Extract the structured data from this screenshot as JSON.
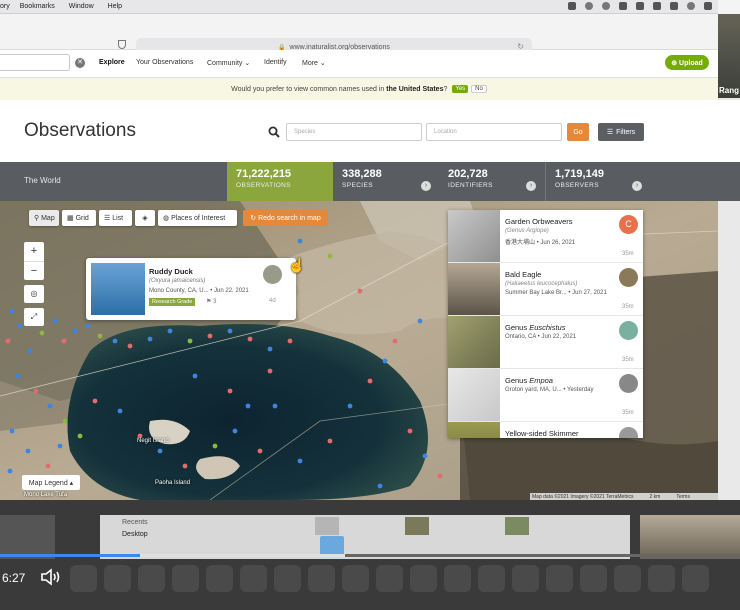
{
  "menubar": {
    "items": [
      "ory",
      "Bookmarks",
      "Window",
      "Help"
    ]
  },
  "sidecam": {
    "label": "Rang"
  },
  "browser": {
    "url": "www.inaturalist.org/observations"
  },
  "nav": {
    "items": [
      "Explore",
      "Your Observations",
      "Community ⌄",
      "Identify",
      "More ⌄"
    ],
    "upload": "⊕ Upload"
  },
  "banner": {
    "text_pre": "Would you prefer to view common names used in",
    "country": "the United States",
    "text_post": "?",
    "yes": "Yes",
    "no": "No"
  },
  "page": {
    "title": "Observations",
    "species_placeholder": "Species",
    "location_placeholder": "Location",
    "go": "Go",
    "filters": "Filters"
  },
  "stats": {
    "place": "The World",
    "observations": {
      "num": "71,222,215",
      "label": "OBSERVATIONS"
    },
    "species": {
      "num": "338,288",
      "label": "SPECIES"
    },
    "identifiers": {
      "num": "202,728",
      "label": "IDENTIFIERS"
    },
    "observers": {
      "num": "1,719,149",
      "label": "OBSERVERS"
    }
  },
  "map": {
    "controls": [
      "Map",
      "Grid",
      "List",
      "",
      "Places of Interest"
    ],
    "redo": "Redo search in map",
    "legend": "Map Legend ▴",
    "attribution": "Map data ©2021 Imagery ©2021 TerraMetrics",
    "scale": "2 km",
    "terms": "Terms",
    "place_labels": [
      "Negit Island",
      "Paoha Island",
      "Mono Lake Tufa"
    ]
  },
  "popup": {
    "name": "Ruddy Duck",
    "sci": "(Oxyura jamaicensis)",
    "loc": "Mono County, CA, U... • Jun 22, 2021",
    "grade": "Research Grade",
    "ids": "3",
    "ago": "4d"
  },
  "obs": [
    {
      "title": "Garden Orbweavers",
      "sub": "(Genus Argiope)",
      "meta": "香港大埔山 • Jun 26, 2021",
      "avatar": "C",
      "avatar_color": "#e8704a",
      "ago": "35m"
    },
    {
      "title": "Bald Eagle",
      "sub": "(Haliaeetus leucocephalus)",
      "meta": "Summer Bay Lake Br... • Jun 27, 2021",
      "avatar": "",
      "avatar_color": "#8a7a5a",
      "ago": "35m"
    },
    {
      "title_pre": "Genus ",
      "title_it": "Euschistus",
      "meta": "Ontario, CA • Jun 22, 2021",
      "avatar": "",
      "avatar_color": "#7ab0a0",
      "ago": "35m"
    },
    {
      "title_pre": "Genus ",
      "title_it": "Empoa",
      "meta": "Groton yard, MA, U... • Yesterday",
      "avatar": "",
      "avatar_color": "#888",
      "ago": "35m"
    },
    {
      "title": "Yellow-sided Skimmer",
      "avatar": "",
      "avatar_color": "#999"
    }
  ],
  "dock": {
    "recents": "Recents",
    "desktop": "Desktop",
    "time": "6:27"
  }
}
